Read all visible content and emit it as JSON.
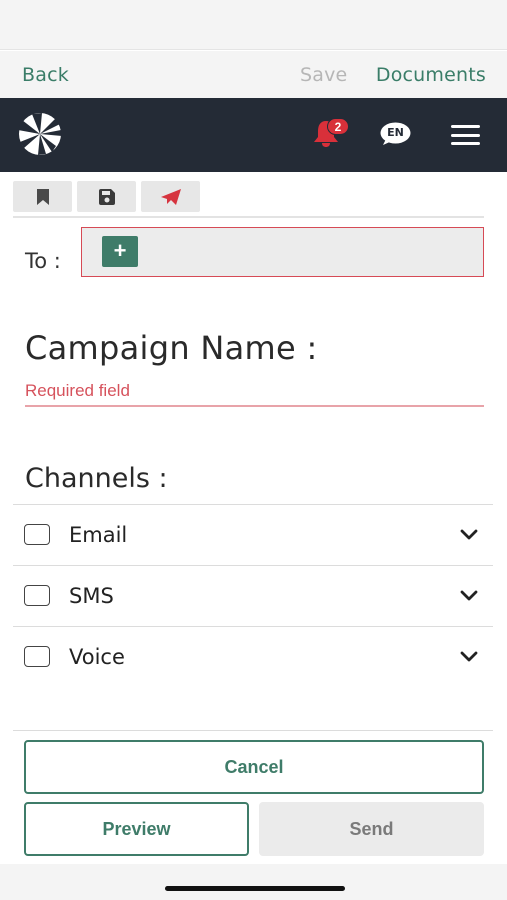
{
  "nav": {
    "back_label": "Back",
    "save_label": "Save",
    "documents_label": "Documents"
  },
  "header": {
    "logo_icon": "pinwheel-logo-icon",
    "notifications_icon": "bell-icon",
    "notification_count": "2",
    "language": "EN",
    "menu_icon": "hamburger-menu-icon",
    "background_color": "#242b36",
    "bell_color": "#d8303a"
  },
  "toolbar": {
    "items": [
      {
        "icon": "bookmark-icon"
      },
      {
        "icon": "floppy-disk-icon"
      },
      {
        "icon": "paper-plane-icon",
        "color": "#d6343f"
      }
    ]
  },
  "to": {
    "label": "To :",
    "add_button": "+"
  },
  "campaign": {
    "label": "Campaign Name :",
    "error": "Required field",
    "error_color": "#d6525c"
  },
  "channels": {
    "label": "Channels :",
    "items": [
      {
        "name": "Email",
        "checked": false
      },
      {
        "name": "SMS",
        "checked": false
      },
      {
        "name": "Voice",
        "checked": false
      }
    ]
  },
  "actions": {
    "cancel": "Cancel",
    "preview": "Preview",
    "send": "Send",
    "accent_color": "#3f7c69"
  }
}
